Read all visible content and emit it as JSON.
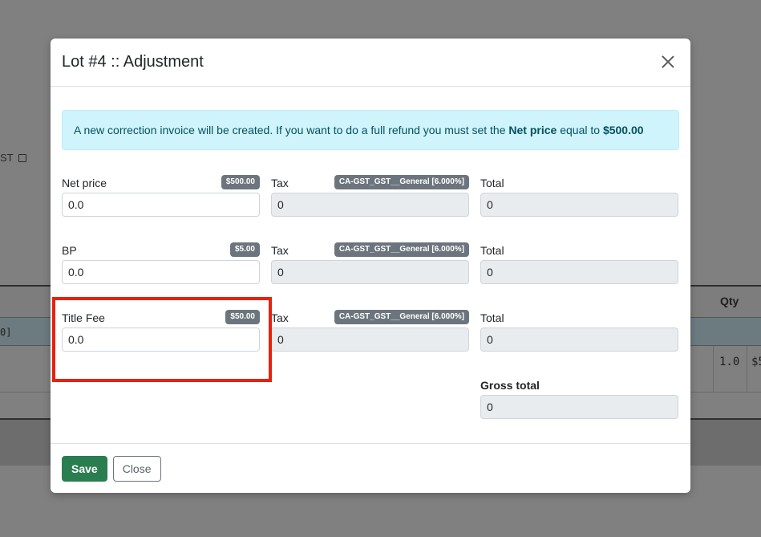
{
  "background": {
    "link_text": "ST",
    "table": {
      "qty_header": "Qty",
      "row_code": "0]",
      "qty_value": "1.0",
      "price_value": "$5"
    }
  },
  "modal": {
    "title": "Lot #4 :: Adjustment",
    "alert": {
      "prefix": "A new correction invoice will be created. If you want to do a full refund you must set the ",
      "bold_label": "Net price",
      "middle": " equal to ",
      "bold_amount": "$500.00"
    },
    "rows": [
      {
        "label": "Net price",
        "badge": "$500.00",
        "value": "0.0",
        "tax_label": "Tax",
        "tax_badge": "CA-GST_GST__General [6.000%]",
        "tax_value": "0",
        "total_label": "Total",
        "total_value": "0"
      },
      {
        "label": "BP",
        "badge": "$5.00",
        "value": "0.0",
        "tax_label": "Tax",
        "tax_badge": "CA-GST_GST__General [6.000%]",
        "tax_value": "0",
        "total_label": "Total",
        "total_value": "0"
      },
      {
        "label": "Title Fee",
        "badge": "$50.00",
        "value": "0.0",
        "tax_label": "Tax",
        "tax_badge": "CA-GST_GST__General [6.000%]",
        "tax_value": "0",
        "total_label": "Total",
        "total_value": "0"
      }
    ],
    "gross_total": {
      "label": "Gross total",
      "value": "0"
    },
    "footer": {
      "save_label": "Save",
      "close_label": "Close"
    }
  },
  "colors": {
    "save_button": "#2a7d4f",
    "alert_bg": "#cff4fc",
    "highlight": "#e8210f",
    "badge": "#6c757d"
  }
}
